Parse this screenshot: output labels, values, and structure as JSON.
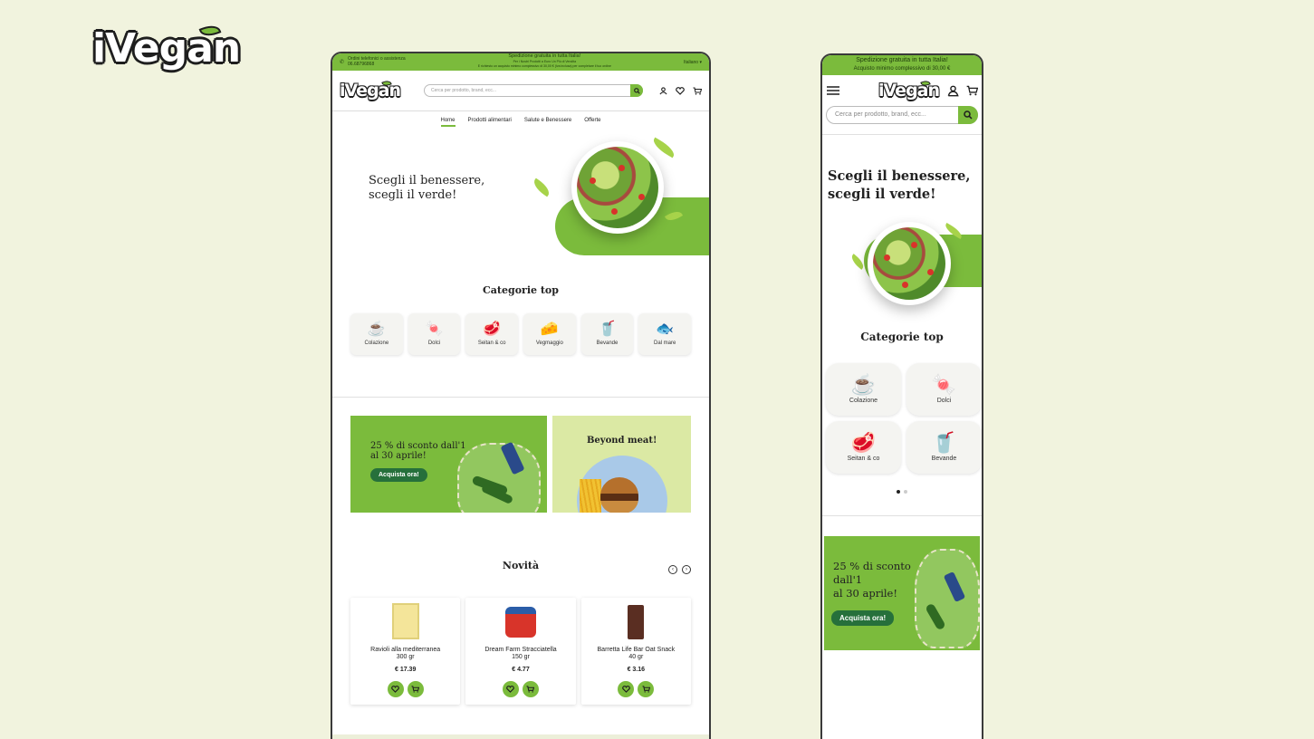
{
  "brand": {
    "logo_text": "iVegan",
    "accent": "#7bbb3c",
    "dark_green": "#26703b",
    "background": "#f1f3de"
  },
  "desktop": {
    "topbar": {
      "contact_label": "Ordini telefonici o assistenza",
      "phone": "06.68796868",
      "shipping_title": "Spedizione gratuita in tutta Italia!",
      "shipping_line2": "Per i Nostri Prodotti a Euro Un Più di Vendita",
      "shipping_line3": "E richiesto un acquisto minimo complessivo di 30,00 € (Iva inclusa) per completare il tuo ordine",
      "language": "Italiano"
    },
    "search": {
      "placeholder": "Cerca per prodotto, brand, ecc..."
    },
    "nav": [
      "Home",
      "Prodotti alimentari",
      "Salute e Benessere",
      "Offerte"
    ],
    "hero": {
      "line1": "Scegli il benessere,",
      "line2": "scegli il verde!"
    },
    "categories_title": "Categorie top",
    "categories": [
      {
        "label": "Colazione",
        "icon": "breakfast-icon",
        "glyph": "☕"
      },
      {
        "label": "Dolci",
        "icon": "candy-icon",
        "glyph": "🍬"
      },
      {
        "label": "Seitan & co",
        "icon": "steak-icon",
        "glyph": "🥩"
      },
      {
        "label": "Vegmaggio",
        "icon": "cheese-icon",
        "glyph": "🧀"
      },
      {
        "label": "Bevande",
        "icon": "drink-icon",
        "glyph": "🥤"
      },
      {
        "label": "Dal mare",
        "icon": "fish-icon",
        "glyph": "🐟"
      }
    ],
    "promo1": {
      "line1": "25 % di sconto dall'1",
      "line2": "al 30 aprile!",
      "cta": "Acquista ora!"
    },
    "promo2": {
      "title": "Beyond meat!"
    },
    "novita_title": "Novità",
    "products": [
      {
        "name": "Ravioli alla mediterranea",
        "weight": "300 gr",
        "price": "€ 17.39"
      },
      {
        "name": "Dream Farm Stracciatella",
        "weight": "150 gr",
        "price": "€ 4.77"
      },
      {
        "name": "Barretta Life Bar Oat Snack",
        "weight": "40 gr",
        "price": "€ 3.16"
      }
    ]
  },
  "mobile": {
    "topbar_line1": "Spedizione gratuita in tutta Italia!",
    "topbar_line2": "Acquisto minimo complessivo di 30,00 €",
    "search_placeholder": "Cerca per prodotto, brand, ecc...",
    "hero_line1": "Scegli il benessere,",
    "hero_line2": "scegli il verde!",
    "categories_title": "Categorie top",
    "categories": [
      {
        "label": "Colazione",
        "icon": "breakfast-icon",
        "glyph": "☕"
      },
      {
        "label": "Dolci",
        "icon": "candy-icon",
        "glyph": "🍬"
      },
      {
        "label": "Seitan & co",
        "icon": "steak-icon",
        "glyph": "🥩"
      },
      {
        "label": "Bevande",
        "icon": "drink-icon",
        "glyph": "🥤"
      }
    ],
    "promo": {
      "line1": "25 % di sconto",
      "line2": "dall'1",
      "line3": "al 30 aprile!",
      "cta": "Acquista ora!"
    }
  }
}
